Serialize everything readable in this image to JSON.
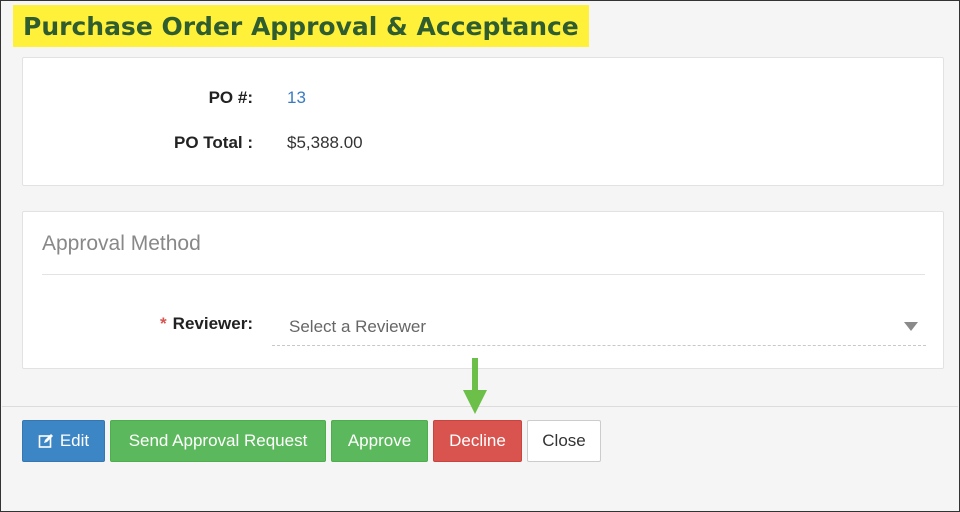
{
  "page": {
    "title": "Purchase Order Approval & Acceptance"
  },
  "po_details": {
    "po_number_label": "PO #:",
    "po_number_value": "13",
    "po_total_label": "PO Total :",
    "po_total_value": "$5,388.00"
  },
  "approval": {
    "section_title": "Approval Method",
    "required_marker": "*",
    "reviewer_label": "Reviewer:",
    "reviewer_placeholder": "Select a Reviewer"
  },
  "buttons": {
    "edit_label": "Edit",
    "send_label": "Send Approval Request",
    "approve_label": "Approve",
    "decline_label": "Decline",
    "close_label": "Close"
  },
  "colors": {
    "title_highlight": "#fff13a",
    "title_text": "#2f5d2f",
    "primary": "#3d86c6",
    "success": "#5cb85c",
    "danger": "#d9534f",
    "annotation_arrow": "#6cc04a"
  },
  "icons": {
    "edit": "edit-icon",
    "dropdown": "caret-down-icon",
    "annotation": "arrow-down-icon"
  }
}
